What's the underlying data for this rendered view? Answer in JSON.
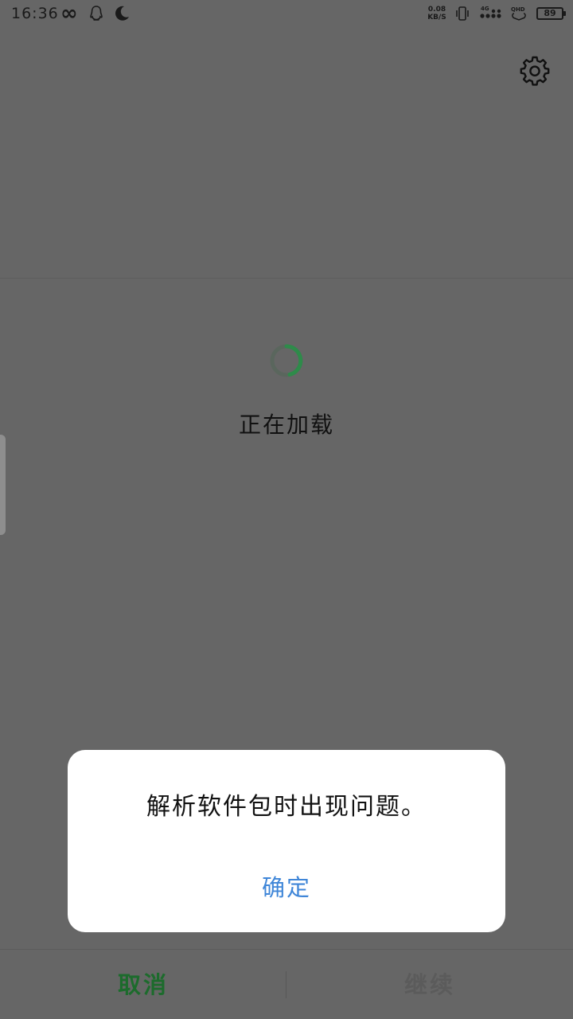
{
  "status_bar": {
    "time": "16:36",
    "net_speed_value": "0.08",
    "net_speed_unit": "KB/S",
    "battery_level": "89",
    "icons": [
      "infinity-icon",
      "qq-icon",
      "moon-icon",
      "vibrate-icon",
      "signal-4g-icon",
      "hd-signal-icon",
      "battery-icon"
    ]
  },
  "header": {
    "settings_icon": "gear-icon"
  },
  "loading": {
    "text": "正在加载",
    "spinner_color": "#2e8b4a"
  },
  "dialog": {
    "message": "解析软件包时出现问题。",
    "ok_label": "确定",
    "ok_color": "#3f86d8"
  },
  "bottom_bar": {
    "cancel_label": "取消",
    "continue_label": "继续",
    "cancel_color": "#1c6b2c"
  }
}
